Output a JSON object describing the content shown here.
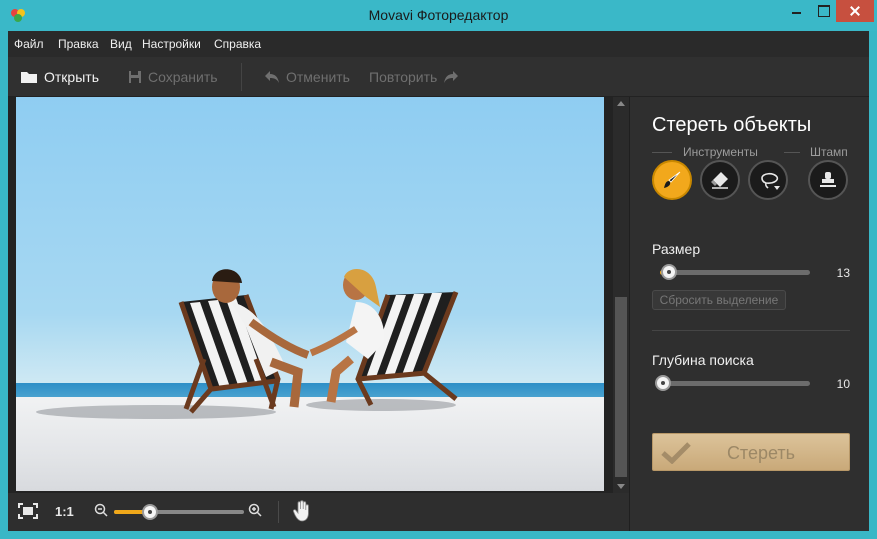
{
  "window": {
    "title": "Movavi Фоторедактор"
  },
  "menu": {
    "items": [
      "Файл",
      "Правка",
      "Вид",
      "Настройки",
      "Справка"
    ]
  },
  "toolbar": {
    "open_label": "Открыть",
    "save_label": "Сохранить",
    "undo_label": "Отменить",
    "redo_label": "Повторить"
  },
  "bottombar": {
    "actual_size_label": "1:1",
    "zoom_fraction": 0.28
  },
  "panel": {
    "title": "Стереть объекты",
    "tools_label": "Инструменты",
    "stamp_label": "Штамп",
    "tools": [
      "brush-icon",
      "eraser-icon",
      "lasso-icon",
      "stamp-icon"
    ],
    "active_tool": "brush-icon",
    "size_label": "Размер",
    "size_value": "13",
    "size_fraction": 0.06,
    "reset_label": "Сбросить выделение",
    "depth_label": "Глубина поиска",
    "depth_value": "10",
    "depth_fraction": 0.02,
    "erase_label": "Стереть"
  },
  "colors": {
    "titlebar": "#3ab8c8",
    "accent": "#f0a81a",
    "close": "#c7503f"
  }
}
